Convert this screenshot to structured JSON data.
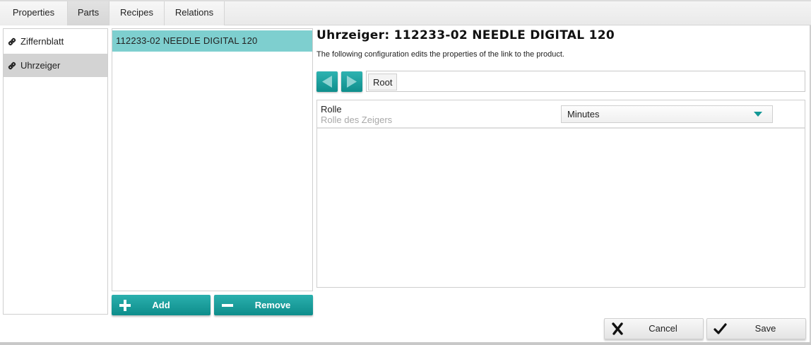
{
  "tabs": [
    {
      "label": "Properties"
    },
    {
      "label": "Parts"
    },
    {
      "label": "Recipes"
    },
    {
      "label": "Relations"
    }
  ],
  "active_tab": "Parts",
  "links": [
    {
      "label": "Ziffernblatt",
      "icon": "link-icon"
    },
    {
      "label": "Uhrzeiger",
      "icon": "link-icon",
      "selected": true
    }
  ],
  "parts": [
    {
      "label": "112233-02 NEEDLE DIGITAL 120",
      "selected": true
    }
  ],
  "parts_actions": {
    "add_label": "Add",
    "remove_label": "Remove"
  },
  "detail": {
    "title": "Uhrzeiger: 112233-02 NEEDLE DIGITAL 120",
    "subtitle": "The following configuration edits the properties of the link to the product.",
    "breadcrumb": [
      "Root"
    ],
    "properties": [
      {
        "name": "Rolle",
        "description": "Rolle des Zeigers",
        "value": "Minutes"
      }
    ]
  },
  "footer": {
    "cancel_label": "Cancel",
    "save_label": "Save"
  },
  "colors": {
    "accent": "#139896",
    "selected_row": "#7ecfcf",
    "selected_link": "#d3d3d3"
  }
}
